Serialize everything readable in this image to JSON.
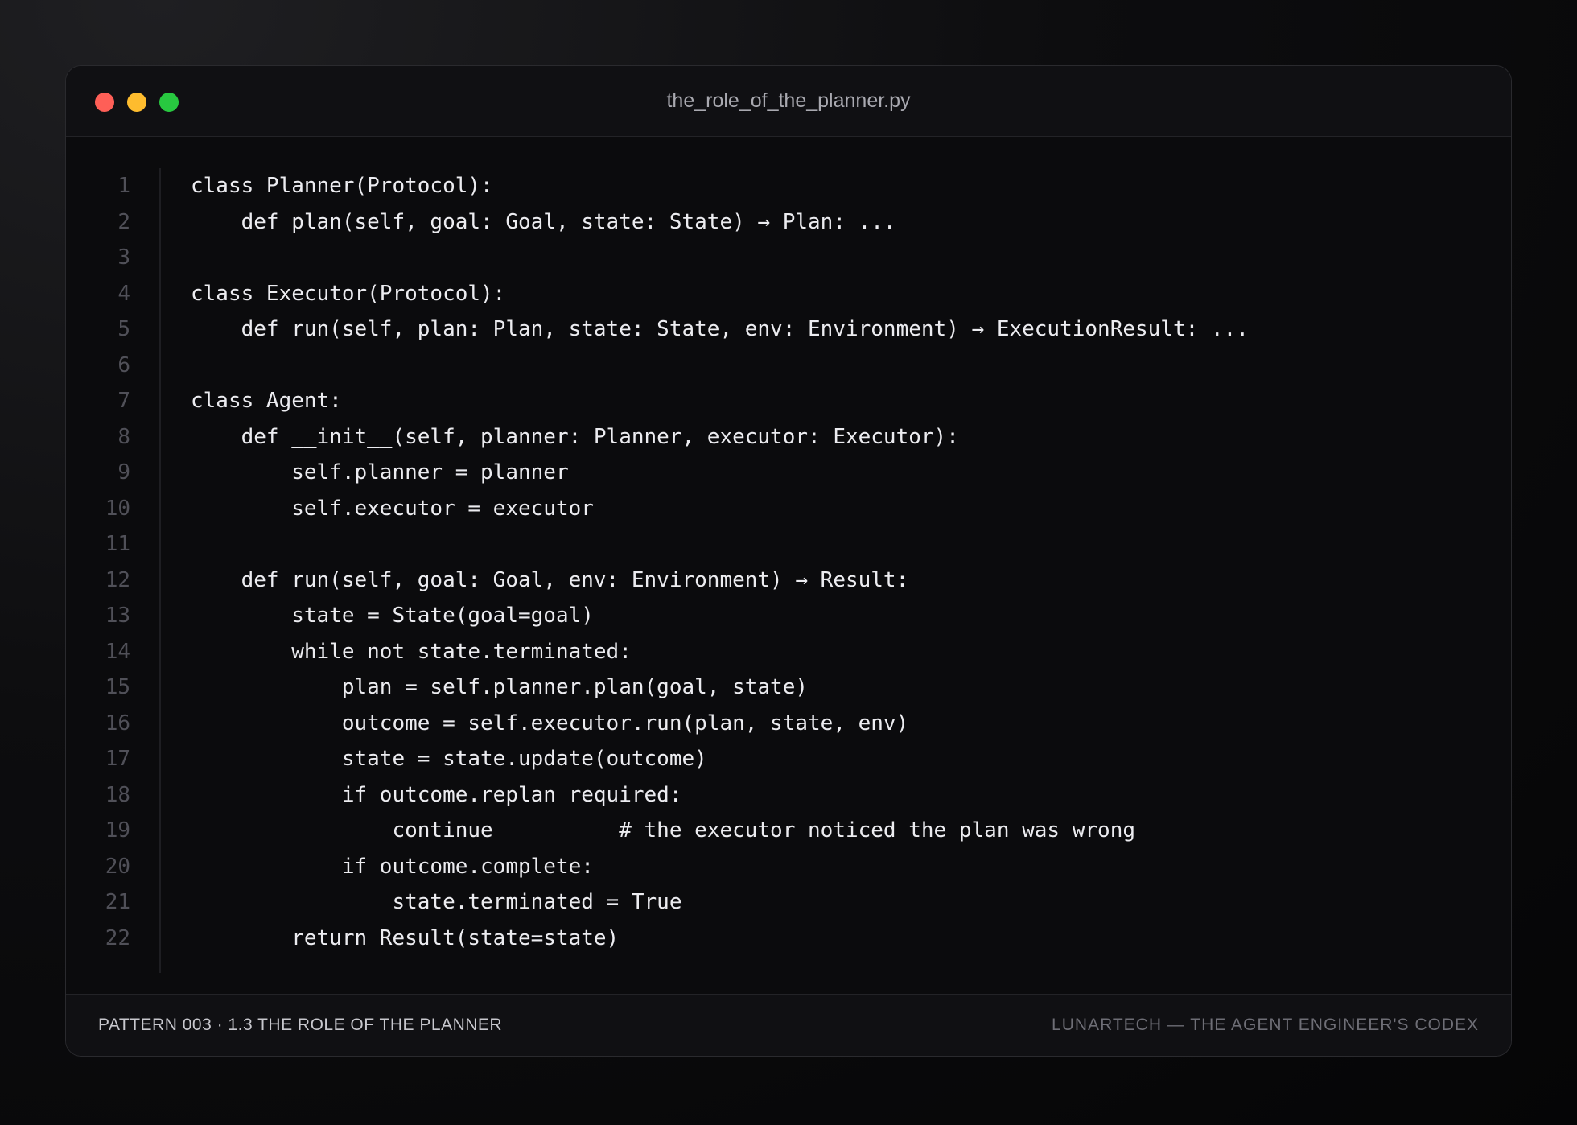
{
  "window": {
    "title": "the_role_of_the_planner.py",
    "controls": [
      "close",
      "minimize",
      "maximize"
    ],
    "colors": {
      "close": "#fe5f57",
      "minimize": "#febc2e",
      "maximize": "#28c840"
    }
  },
  "code": {
    "language": "python",
    "lines": [
      "class Planner(Protocol):",
      "    def plan(self, goal: Goal, state: State) → Plan: ...",
      "",
      "class Executor(Protocol):",
      "    def run(self, plan: Plan, state: State, env: Environment) → ExecutionResult: ...",
      "",
      "class Agent:",
      "    def __init__(self, planner: Planner, executor: Executor):",
      "        self.planner = planner",
      "        self.executor = executor",
      "",
      "    def run(self, goal: Goal, env: Environment) → Result:",
      "        state = State(goal=goal)",
      "        while not state.terminated:",
      "            plan = self.planner.plan(goal, state)",
      "            outcome = self.executor.run(plan, state, env)",
      "            state = state.update(outcome)",
      "            if outcome.replan_required:",
      "                continue          # the executor noticed the plan was wrong",
      "            if outcome.complete:",
      "                state.terminated = True",
      "        return Result(state=state)"
    ]
  },
  "footer": {
    "left": "PATTERN 003 · 1.3 THE ROLE OF THE PLANNER",
    "right": "LUNARTECH — THE AGENT ENGINEER'S CODEX"
  }
}
